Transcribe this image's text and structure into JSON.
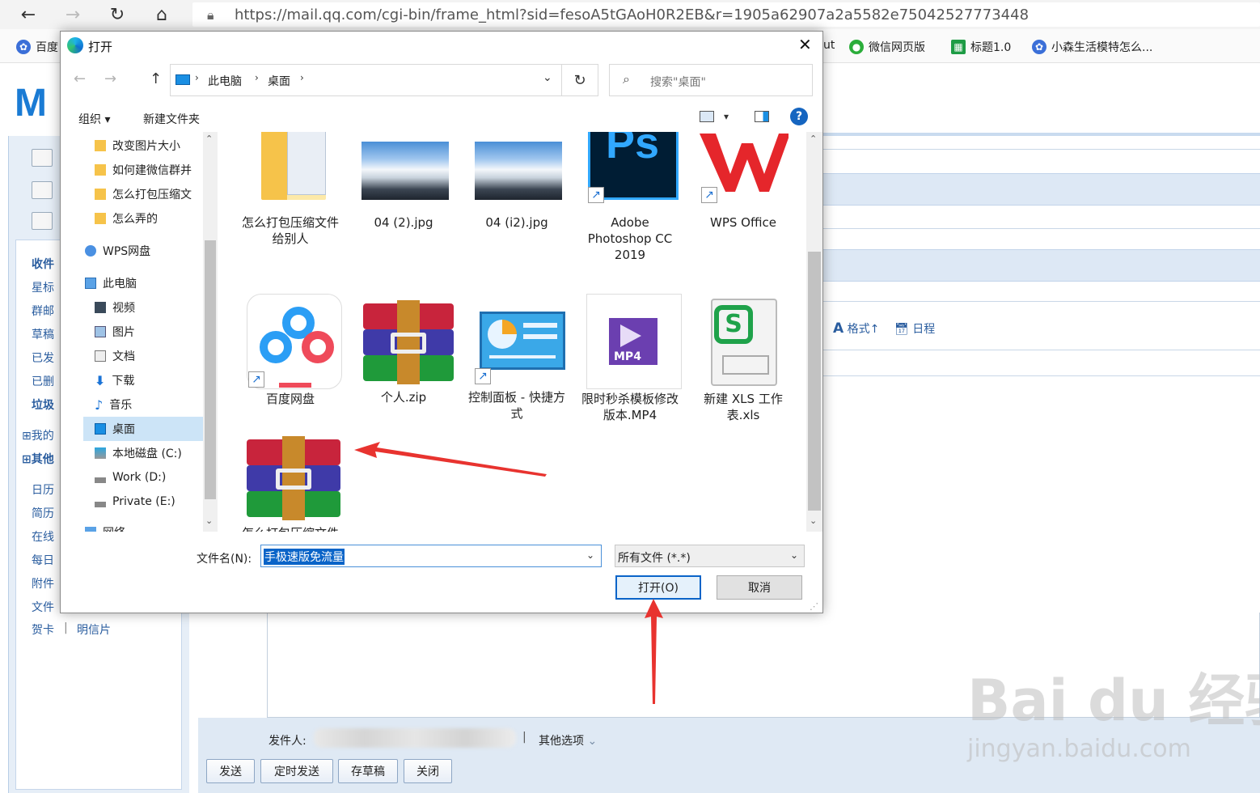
{
  "browser": {
    "url": "https://mail.qq.com/cgi-bin/frame_html?sid=fesoA5tGAoH0R2EB&r=1905a62907a2a5582e75042527773448",
    "bookmarks": [
      "百度",
      "ut",
      "微信网页版",
      "标题1.0",
      "小森生活模特怎么..."
    ]
  },
  "mail": {
    "logo": "M",
    "sidebar": [
      "收件",
      "星标",
      "群邮",
      "草稿",
      "已发",
      "已删",
      "垃圾",
      "我的",
      "其他",
      "日历",
      "简历",
      "在线",
      "每日",
      "附件",
      "文件",
      "贺卡",
      "|",
      "明信片"
    ],
    "toolbar": {
      "format": "格式",
      "schedule": "日程"
    },
    "sender_label": "发件人:",
    "separator": "|",
    "more_options": "其他选项",
    "buttons": {
      "send": "发送",
      "timed_send": "定时发送",
      "save_draft": "存草稿",
      "close": "关闭"
    }
  },
  "dialog": {
    "title": "打开",
    "close": "✕",
    "breadcrumb": [
      "此电脑",
      "桌面"
    ],
    "search_placeholder": "搜索\"桌面\"",
    "commands": {
      "organize": "组织 ▾",
      "new_folder": "新建文件夹"
    },
    "tree": [
      {
        "label": "改变图片大小",
        "icon": "folder"
      },
      {
        "label": "如何建微信群并",
        "icon": "folder"
      },
      {
        "label": "怎么打包压缩文",
        "icon": "folder"
      },
      {
        "label": "怎么弄的",
        "icon": "folder"
      },
      {
        "label": "WPS网盘",
        "icon": "cloud"
      },
      {
        "label": "此电脑",
        "icon": "pc"
      },
      {
        "label": "视频",
        "icon": "video"
      },
      {
        "label": "图片",
        "icon": "picture"
      },
      {
        "label": "文档",
        "icon": "document"
      },
      {
        "label": "下载",
        "icon": "download"
      },
      {
        "label": "音乐",
        "icon": "music"
      },
      {
        "label": "桌面",
        "icon": "desktop",
        "selected": true
      },
      {
        "label": "本地磁盘 (C:)",
        "icon": "disk"
      },
      {
        "label": "Work (D:)",
        "icon": "drive"
      },
      {
        "label": "Private (E:)",
        "icon": "drive"
      },
      {
        "label": "网络",
        "icon": "network"
      }
    ],
    "files": [
      {
        "name": "怎么打包压缩文件给别人",
        "type": "folder"
      },
      {
        "name": "04 (2).jpg",
        "type": "image"
      },
      {
        "name": "04 (i2).jpg",
        "type": "image"
      },
      {
        "name": "Adobe Photoshop CC 2019",
        "type": "photoshop",
        "shortcut": true
      },
      {
        "name": "WPS Office",
        "type": "wps",
        "shortcut": true
      },
      {
        "name": "百度网盘",
        "type": "baidu",
        "shortcut": true
      },
      {
        "name": "个人.zip",
        "type": "archive"
      },
      {
        "name": "控制面板 - 快捷方式",
        "type": "control-panel",
        "shortcut": true
      },
      {
        "name": "限时秒杀模板修改版本.MP4",
        "type": "mp4"
      },
      {
        "name": "新建 XLS 工作表.xls",
        "type": "xls"
      },
      {
        "name": "怎么打包压缩文件给别人.rar",
        "type": "archive"
      }
    ],
    "filename_label": "文件名(N):",
    "filename_value": "手极速版免流量",
    "filter_value": "所有文件 (*.*)",
    "open_button": "打开(O)",
    "cancel_button": "取消",
    "ps_text": "Ps",
    "mp4_text": "MP4"
  },
  "watermark": {
    "main": "Bai du 经验",
    "sub": "jingyan.baidu.com"
  }
}
